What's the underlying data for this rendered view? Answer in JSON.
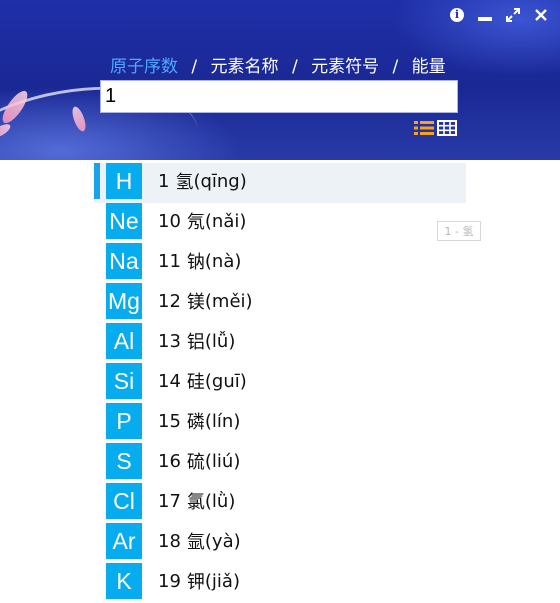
{
  "window": {
    "controls": [
      {
        "name": "info-icon"
      },
      {
        "name": "minimize-icon"
      },
      {
        "name": "maximize-icon"
      },
      {
        "name": "close-icon"
      }
    ]
  },
  "search": {
    "breadcrumb": [
      "原子序数",
      "元素名称",
      "元素符号",
      "能量"
    ],
    "active_index": 0,
    "separator": "/",
    "value": "1"
  },
  "view_toggle": [
    "list-view-icon",
    "grid-view-icon"
  ],
  "elements": [
    {
      "symbol": "H",
      "number": "1",
      "name": "氢",
      "pinyin": "(qīng)"
    },
    {
      "symbol": "Ne",
      "number": "10",
      "name": "氖",
      "pinyin": "(nǎi)"
    },
    {
      "symbol": "Na",
      "number": "11",
      "name": "钠",
      "pinyin": "(nà)"
    },
    {
      "symbol": "Mg",
      "number": "12",
      "name": "镁",
      "pinyin": "(měi)"
    },
    {
      "symbol": "Al",
      "number": "13",
      "name": "铝",
      "pinyin": "(lǚ)"
    },
    {
      "symbol": "Si",
      "number": "14",
      "name": "硅",
      "pinyin": "(guī)"
    },
    {
      "symbol": "P",
      "number": "15",
      "name": "磷",
      "pinyin": "(lín)"
    },
    {
      "symbol": "S",
      "number": "16",
      "name": "硫",
      "pinyin": "(liú)"
    },
    {
      "symbol": "Cl",
      "number": "17",
      "name": "氯",
      "pinyin": "(lǜ)"
    },
    {
      "symbol": "Ar",
      "number": "18",
      "name": "氩",
      "pinyin": "(yà)"
    },
    {
      "symbol": "K",
      "number": "19",
      "name": "钾",
      "pinyin": "(jiǎ)"
    }
  ],
  "selected_index": 0,
  "tag": "1 - 氢",
  "colors": {
    "symbol_bg": "#07acef",
    "accent": "#1ba2ea",
    "selected_row": "#edf2f7",
    "header": "#1f2fa8"
  }
}
